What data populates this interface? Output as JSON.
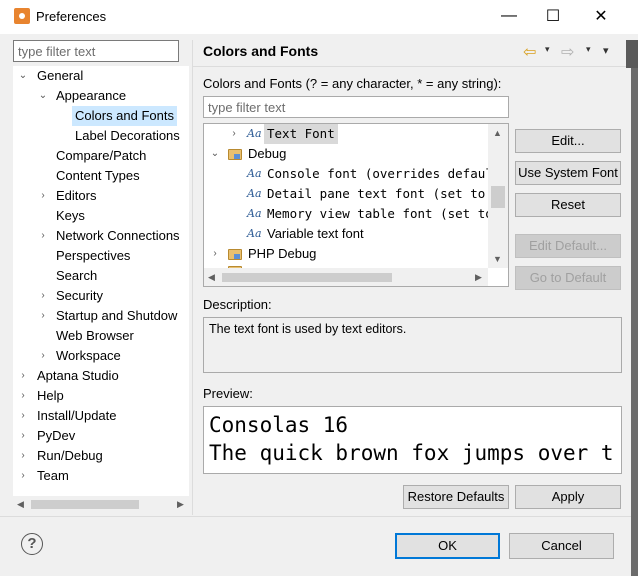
{
  "window": {
    "title": "Preferences",
    "minimize": "—",
    "maximize": "☐",
    "close": "✕"
  },
  "left": {
    "filter_placeholder": "type filter text",
    "tree": [
      {
        "label": "General",
        "tw": "⌄"
      },
      {
        "label": "Appearance",
        "tw": "⌄"
      },
      {
        "label": "Colors and Fonts",
        "tw": ""
      },
      {
        "label": "Label Decorations",
        "tw": ""
      },
      {
        "label": "Compare/Patch",
        "tw": ""
      },
      {
        "label": "Content Types",
        "tw": ""
      },
      {
        "label": "Editors",
        "tw": "›"
      },
      {
        "label": "Keys",
        "tw": ""
      },
      {
        "label": "Network Connections",
        "tw": "›"
      },
      {
        "label": "Perspectives",
        "tw": ""
      },
      {
        "label": "Search",
        "tw": ""
      },
      {
        "label": "Security",
        "tw": "›"
      },
      {
        "label": "Startup and Shutdow",
        "tw": "›"
      },
      {
        "label": "Web Browser",
        "tw": ""
      },
      {
        "label": "Workspace",
        "tw": "›"
      },
      {
        "label": "Aptana Studio",
        "tw": "›"
      },
      {
        "label": "Help",
        "tw": "›"
      },
      {
        "label": "Install/Update",
        "tw": "›"
      },
      {
        "label": "PyDev",
        "tw": "›"
      },
      {
        "label": "Run/Debug",
        "tw": "›"
      },
      {
        "label": "Team",
        "tw": "›"
      }
    ]
  },
  "header": {
    "title": "Colors and Fonts",
    "back_arrow": "⇦",
    "forward_arrow": "⇨",
    "dropdown": "▾"
  },
  "main": {
    "section_label": "Colors and Fonts (? = any character, * = any string):",
    "filter_placeholder": "type filter text",
    "font_tree": [
      {
        "label": "Text Font",
        "tw": "›",
        "icon": "aa",
        "mono": true
      },
      {
        "label": "Debug",
        "tw": "⌄",
        "icon": "folder",
        "mono": false
      },
      {
        "label": "Console font (overrides default:",
        "tw": "",
        "icon": "aa",
        "mono": true
      },
      {
        "label": "Detail pane text font (set to de",
        "tw": "",
        "icon": "aa",
        "mono": true
      },
      {
        "label": "Memory view table font (set to d",
        "tw": "",
        "icon": "aa",
        "mono": true
      },
      {
        "label": "Variable text font",
        "tw": "",
        "icon": "aa",
        "mono": false
      },
      {
        "label": "PHP Debug",
        "tw": "›",
        "icon": "folder",
        "mono": false
      }
    ],
    "aa_glyph": "Aa",
    "buttons": {
      "edit": "Edit...",
      "use_system_font": "Use System Font",
      "reset": "Reset",
      "edit_default": "Edit Default...",
      "go_to_default": "Go to Default"
    },
    "description_label": "Description:",
    "description_text": "The text font is used by text editors.",
    "preview_label": "Preview:",
    "preview_line1": "Consolas 16",
    "preview_line2": "The quick brown fox jumps over t",
    "restore_defaults": "Restore Defaults",
    "apply": "Apply"
  },
  "footer": {
    "help": "?",
    "ok": "OK",
    "cancel": "Cancel"
  },
  "colors": {
    "selection": "#cce8ff",
    "default_button_border": "#0078d7",
    "disabled_text": "#a0a0a0"
  }
}
